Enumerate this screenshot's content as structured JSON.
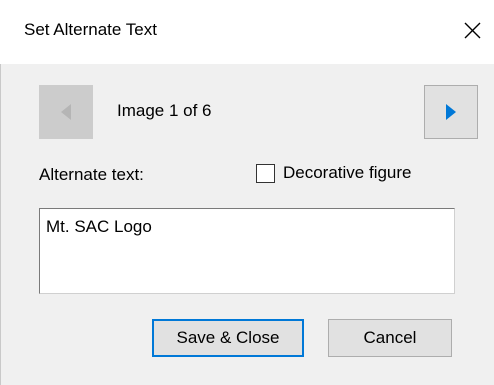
{
  "dialog": {
    "title": "Set Alternate Text",
    "counter": "Image 1 of 6",
    "alt_text_label": "Alternate text:",
    "decorative_label": "Decorative figure",
    "decorative_checked": false,
    "alt_text_value": "Mt. SAC Logo",
    "save_label": "Save & Close",
    "cancel_label": "Cancel"
  },
  "icons": {
    "close": "close-icon",
    "previous": "triangle-left-icon",
    "next": "triangle-right-icon"
  },
  "colors": {
    "accent": "#0078d7",
    "disabled_arrow": "#b5b5b5",
    "dialog_background": "#f0f0f0"
  }
}
